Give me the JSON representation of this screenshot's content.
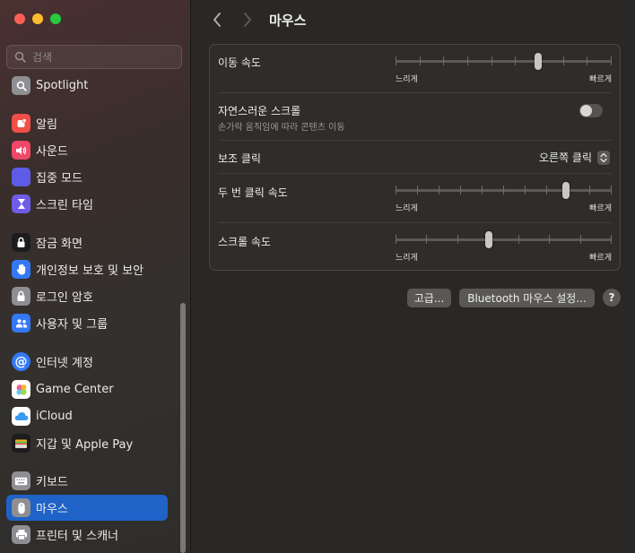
{
  "window": {
    "title": "마우스"
  },
  "search": {
    "placeholder": "검색"
  },
  "sidebar": {
    "items": [
      {
        "label": "Spotlight",
        "icon": "spotlight-icon",
        "color": "#8e8e93"
      },
      {
        "label": "알림",
        "icon": "notifications-icon",
        "color": "#ef4f48"
      },
      {
        "label": "사운드",
        "icon": "sound-icon",
        "color": "#ef4868"
      },
      {
        "label": "집중 모드",
        "icon": "focus-moon-icon",
        "color": "#5e5ce6"
      },
      {
        "label": "스크린 타임",
        "icon": "screen-time-hourglass-icon",
        "color": "#6e5ce6"
      },
      {
        "label": "잠금 화면",
        "icon": "lock-screen-icon",
        "color": "#1c1c1e"
      },
      {
        "label": "개인정보 보호 및 보안",
        "icon": "privacy-hand-icon",
        "color": "#3478f6"
      },
      {
        "label": "로그인 암호",
        "icon": "lock-icon",
        "color": "#8e8e93"
      },
      {
        "label": "사용자 및 그룹",
        "icon": "users-icon",
        "color": "#3478f6"
      },
      {
        "label": "인터넷 계정",
        "icon": "at-sign-icon",
        "color": "#3478f6"
      },
      {
        "label": "Game Center",
        "icon": "game-center-icon",
        "color": "#ffffff"
      },
      {
        "label": "iCloud",
        "icon": "icloud-icon",
        "color": "#ffffff"
      },
      {
        "label": "지갑 및 Apple Pay",
        "icon": "wallet-icon",
        "color": "#1c1c1e"
      },
      {
        "label": "키보드",
        "icon": "keyboard-icon",
        "color": "#8e8e93"
      },
      {
        "label": "마우스",
        "icon": "mouse-icon",
        "color": "#8e8e93",
        "selected": true
      },
      {
        "label": "프린터 및 스캐너",
        "icon": "printer-icon",
        "color": "#8e8e93"
      }
    ]
  },
  "settings": {
    "tracking_speed": {
      "label": "이동 속도",
      "min": "느리게",
      "max": "빠르게",
      "value": 0.66,
      "ticks": 10
    },
    "natural_scroll": {
      "label": "자연스러운 스크롤",
      "sub": "손가락 움직임에 따라 콘텐츠 이동",
      "on": false
    },
    "secondary_click": {
      "label": "보조 클릭",
      "value": "오른쪽 클릭"
    },
    "double_click_speed": {
      "label": "두 번 클릭 속도",
      "min": "느리게",
      "max": "빠르게",
      "value": 0.79,
      "ticks": 11
    },
    "scroll_speed": {
      "label": "스크롤 속도",
      "min": "느리게",
      "max": "빠르게",
      "value": 0.43,
      "ticks": 8
    }
  },
  "buttons": {
    "advanced": "고급...",
    "bluetooth": "Bluetooth 마우스 설정...",
    "help": "?"
  },
  "colors": {
    "accent": "#1f62c8"
  }
}
